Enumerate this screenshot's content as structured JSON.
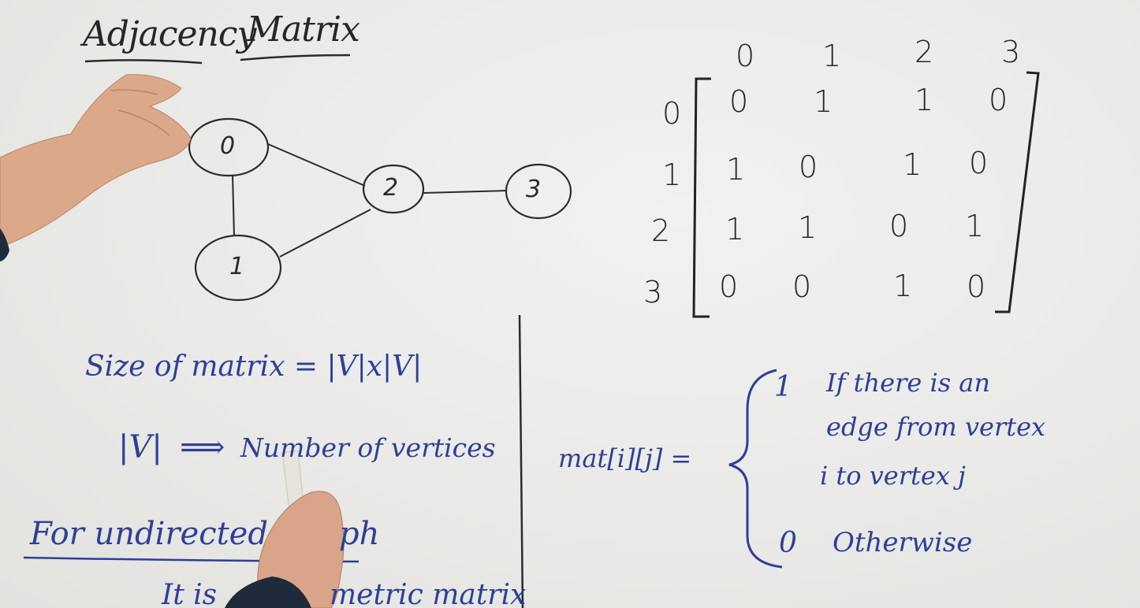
{
  "title": {
    "word1": "Adjacency",
    "word2": "Matrix"
  },
  "graph": {
    "nodes": [
      "0",
      "1",
      "2",
      "3"
    ],
    "edges": [
      [
        "0",
        "1"
      ],
      [
        "0",
        "2"
      ],
      [
        "1",
        "2"
      ],
      [
        "2",
        "3"
      ]
    ]
  },
  "matrix": {
    "col_headers": [
      "0",
      "1",
      "2",
      "3"
    ],
    "row_headers": [
      "0",
      "1",
      "2",
      "3"
    ],
    "rows": [
      [
        "0",
        "1",
        "1",
        "0"
      ],
      [
        "1",
        "0",
        "1",
        "0"
      ],
      [
        "1",
        "1",
        "0",
        "1"
      ],
      [
        "0",
        "0",
        "1",
        "0"
      ]
    ]
  },
  "notes": {
    "size_line": "Size of matrix = |V|x|V|",
    "v_line_left": "|V|",
    "v_line_arrow": "⟹",
    "v_line_right": "Number of vertices",
    "undirected_left": "For undirected",
    "undirected_right": "ph",
    "symmetric_left": "It is",
    "symmetric_right": "metric matrix"
  },
  "definition": {
    "lhs": "mat[i][j] =",
    "case1_value": "1",
    "case1_text": [
      "If there is an",
      "edge from vertex",
      "i to vertex j"
    ],
    "case2_value": "0",
    "case2_text": "Otherwise"
  }
}
